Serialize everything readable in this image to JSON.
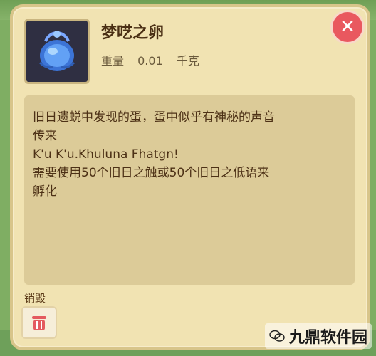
{
  "item": {
    "name": "梦呓之卵",
    "weight_label": "重量",
    "weight_value": "0.01",
    "weight_unit": "千克",
    "icon": "egg-icon"
  },
  "description": {
    "lines": [
      "旧日遗蜕中发现的蛋，蛋中似乎有神秘的声音",
      "传来",
      "K'u K'u.Khuluna Fhatgn!",
      "需要使用50个旧日之触或50个旧日之低语来",
      "孵化"
    ]
  },
  "actions": {
    "destroy_label": "销毁",
    "destroy_icon": "trash-icon",
    "close_icon": "close-icon"
  },
  "watermark": {
    "text": "九鼎软件园",
    "icon": "wechat-icon"
  },
  "colors": {
    "panel": "#f1e3b2",
    "close": "#e9585f",
    "destroy": "#e45a5f",
    "text": "#4a2f14"
  }
}
